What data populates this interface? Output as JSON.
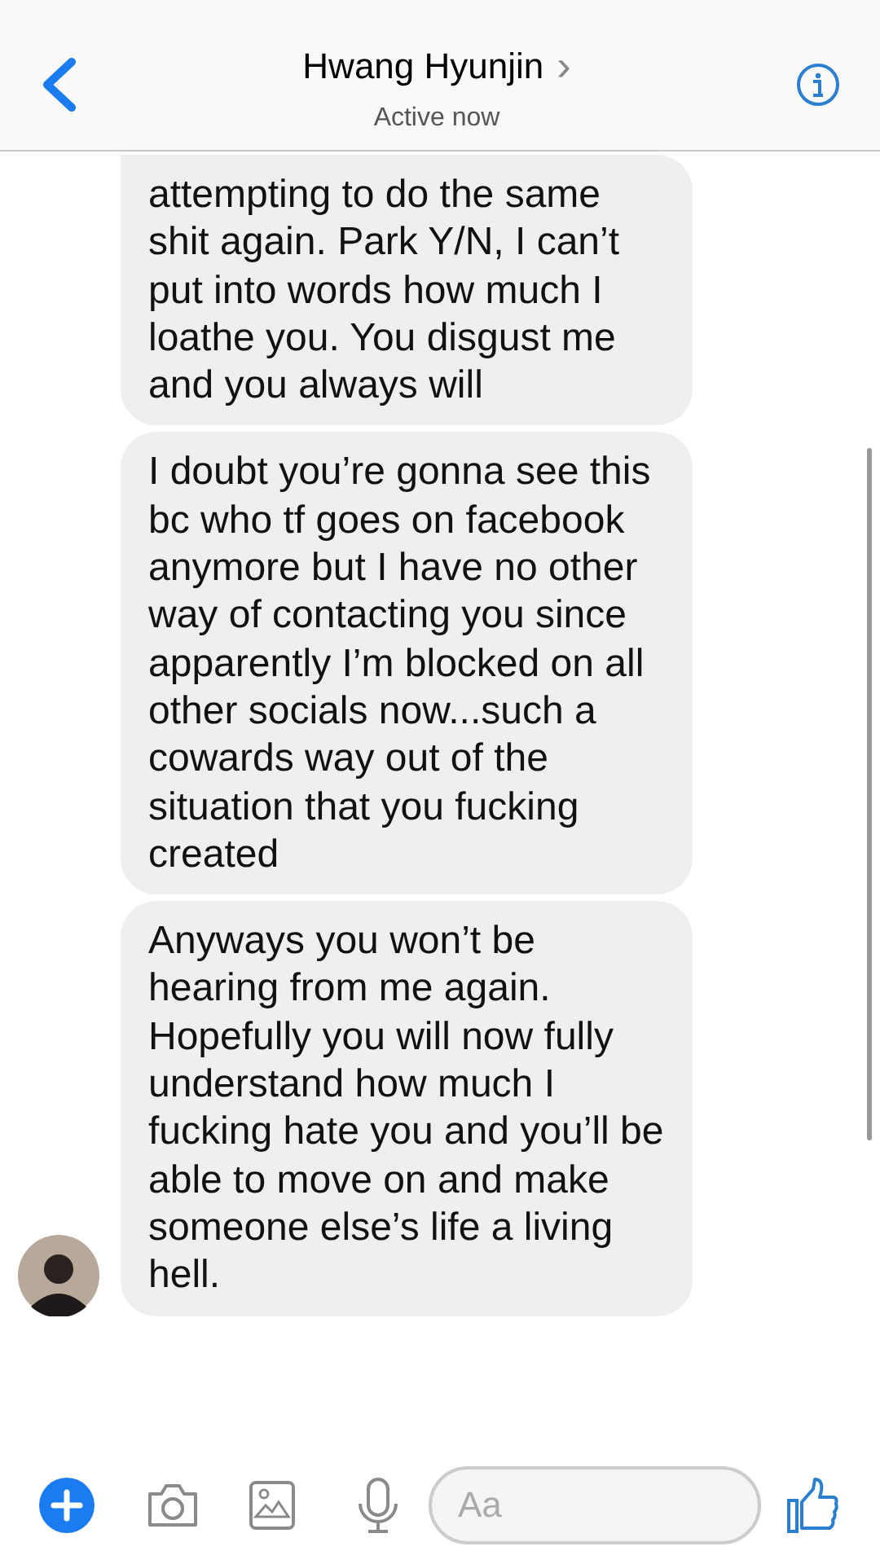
{
  "header": {
    "name": "Hwang Hyunjin",
    "chevron": "›",
    "status": "Active now"
  },
  "messages": [
    {
      "text": "attempting to do the same shit again. Park Y/N, I can’t put into words how much I loathe you. You disgust me and you always will",
      "avatar": false
    },
    {
      "text": "I doubt you’re gonna see this bc who tf goes on facebook anymore but I have no other way of contacting you since apparently I’m blocked on all other socials now...such a cowards way out of the situation that you fucking created",
      "avatar": false
    },
    {
      "text": "Anyways you won’t be hearing from me again. Hopefully you will now fully understand how much I fucking hate you and you’ll be able to move on and make someone else’s life a living hell.",
      "avatar": true
    }
  ],
  "composer": {
    "placeholder": "Aa"
  }
}
